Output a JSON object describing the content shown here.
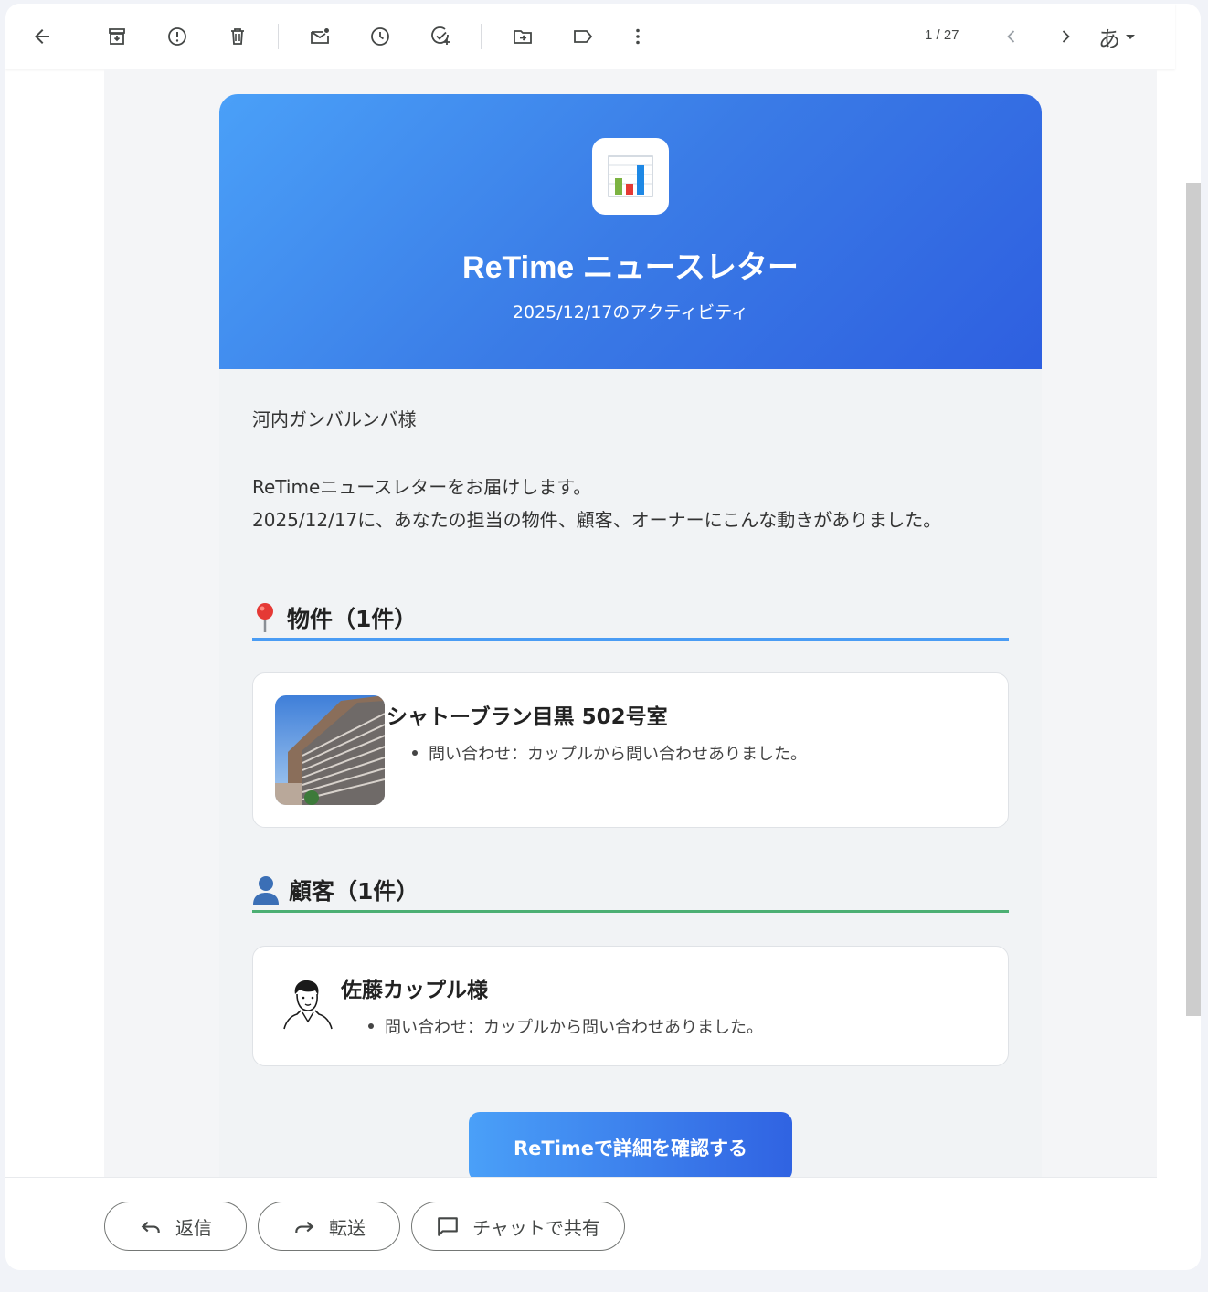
{
  "toolbar": {
    "pager": "1 / 27",
    "input_lang": "あ",
    "icons": [
      "back-arrow-icon",
      "archive-icon",
      "report-spam-icon",
      "delete-icon",
      "mark-unread-icon",
      "snooze-icon",
      "add-task-icon",
      "move-to-icon",
      "label-icon",
      "more-vert-icon",
      "prev-icon",
      "next-icon"
    ]
  },
  "newsletter": {
    "title": "ReTime ニュースレター",
    "subtitle": "2025/12/17のアクティビティ",
    "greeting": "河内ガンバルンバ様",
    "intro_line1": "ReTimeニュースレターをお届けします。",
    "intro_line2": "2025/12/17に、あなたの担当の物件、顧客、オーナーにこんな動きがありました。",
    "property_section": {
      "title": "物件（1件）",
      "item_title": "シャトーブラン目黒 502号室",
      "item_bullet": "問い合わせ：カップルから問い合わせありました。"
    },
    "customer_section": {
      "title": "顧客（1件）",
      "item_title": "佐藤カップル様",
      "item_bullet": "問い合わせ：カップルから問い合わせありました。"
    },
    "cta_label": "ReTimeで詳細を確認する"
  },
  "actions": {
    "reply": "返信",
    "forward": "転送",
    "share_chat": "チャットで共有"
  },
  "colors": {
    "hero_start": "#4aa0f8",
    "hero_end": "#2e5fe0",
    "property_rule": "#4a9cf4",
    "customer_rule": "#4caf73"
  }
}
